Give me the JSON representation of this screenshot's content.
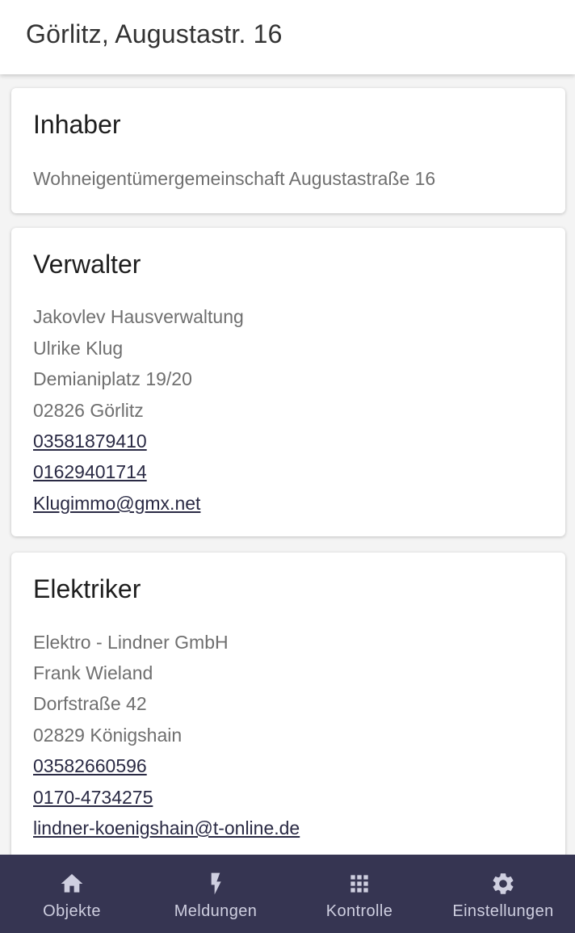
{
  "header": {
    "title": "Görlitz, Augustastr. 16"
  },
  "owner_card": {
    "title": "Inhaber",
    "lines": [
      "Wohneigentümergemeinschaft Augustastraße 16"
    ]
  },
  "manager_card": {
    "title": "Verwalter",
    "company": "Jakovlev Hausverwaltung",
    "person": "Ulrike Klug",
    "street": "Demianiplatz 19/20",
    "city": "02826 Görlitz",
    "phone": "03581879410",
    "mobile": "01629401714",
    "email": "Klugimmo@gmx.net"
  },
  "electrician_card": {
    "title": "Elektriker",
    "company": "Elektro - Lindner GmbH",
    "person": "Frank Wieland",
    "street": "Dorfstraße 42",
    "city": "02829 Königshain",
    "phone": "03582660596",
    "mobile": "0170-4734275",
    "email": "lindner-koenigshain@t-online.de"
  },
  "bottom_nav": {
    "items": [
      {
        "label": "Objekte",
        "icon": "home-icon"
      },
      {
        "label": "Meldungen",
        "icon": "lightning-icon"
      },
      {
        "label": "Kontrolle",
        "icon": "grid-icon"
      },
      {
        "label": "Einstellungen",
        "icon": "gear-icon"
      }
    ]
  },
  "colors": {
    "nav_background": "#363552",
    "nav_text": "#cfcfe0",
    "link_text": "#2a2a44",
    "page_background": "#f4f4f4"
  }
}
